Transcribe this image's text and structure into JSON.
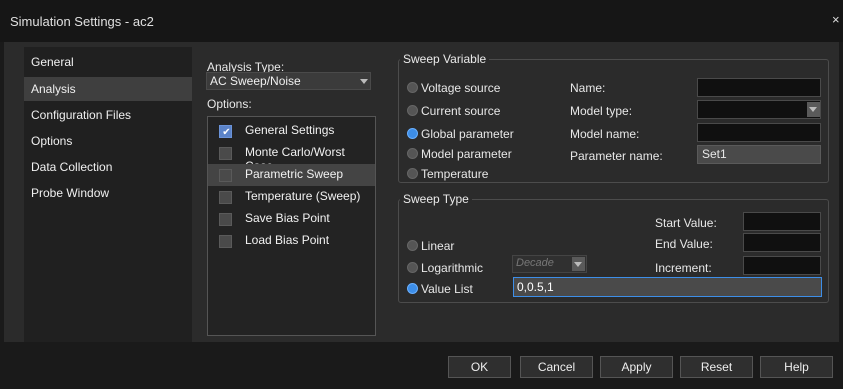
{
  "window": {
    "title": "Simulation Settings - ac2",
    "close_glyph": "×"
  },
  "nav": {
    "items": [
      "General",
      "Analysis",
      "Configuration Files",
      "Options",
      "Data Collection",
      "Probe Window"
    ],
    "selected_index": 1
  },
  "analysis": {
    "type_label": "Analysis Type:",
    "type_value": "AC Sweep/Noise",
    "options_label": "Options:"
  },
  "options": {
    "items": [
      {
        "label": "General Settings",
        "checked": true
      },
      {
        "label": "Monte Carlo/Worst Case",
        "checked": false
      },
      {
        "label": "Parametric Sweep",
        "checked": false
      },
      {
        "label": "Temperature (Sweep)",
        "checked": false
      },
      {
        "label": "Save Bias Point",
        "checked": false
      },
      {
        "label": "Load Bias Point",
        "checked": false
      }
    ],
    "selected_index": 2
  },
  "sweep_variable": {
    "title": "Sweep Variable",
    "radios": [
      "Voltage source",
      "Current source",
      "Global parameter",
      "Model parameter",
      "Temperature"
    ],
    "selected_index": 2,
    "name_label": "Name:",
    "model_type_label": "Model type:",
    "model_name_label": "Model name:",
    "parameter_name_label": "Parameter name:",
    "parameter_name_value": "Set1"
  },
  "sweep_type": {
    "title": "Sweep Type",
    "radios": [
      "Linear",
      "Logarithmic",
      "Value List"
    ],
    "selected_index": 2,
    "log_scale_value": "Decade",
    "start_label": "Start Value:",
    "end_label": "End Value:",
    "increment_label": "Increment:",
    "value_list": "0,0.5,1"
  },
  "buttons": {
    "ok": "OK",
    "cancel": "Cancel",
    "apply": "Apply",
    "reset": "Reset",
    "help": "Help"
  },
  "colors": {
    "accent": "#3d8ee8",
    "selection": "#444444",
    "background": "#2b2b2b"
  }
}
